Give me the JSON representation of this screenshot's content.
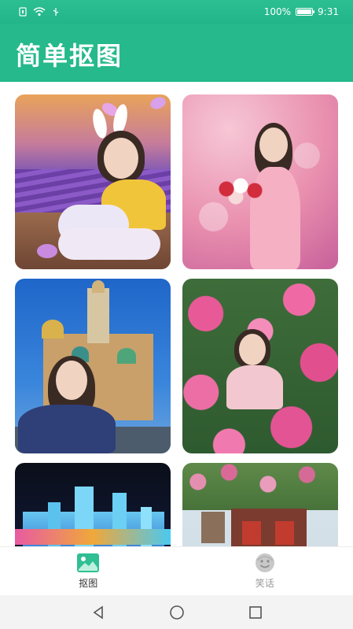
{
  "status": {
    "battery_text": "100%",
    "battery_level": 1.0,
    "time": "9:31"
  },
  "app": {
    "title": "简单抠图"
  },
  "gallery": {
    "items": [
      {
        "name": "lavender-girl"
      },
      {
        "name": "pink-flowers-girl"
      },
      {
        "name": "cathedral-woman"
      },
      {
        "name": "lily-girl"
      },
      {
        "name": "ice-castle"
      },
      {
        "name": "rose-gate"
      }
    ]
  },
  "bottom_nav": {
    "items": [
      {
        "label": "抠图",
        "icon": "image-icon",
        "active": true
      },
      {
        "label": "笑话",
        "icon": "face-icon",
        "active": false
      }
    ]
  },
  "colors": {
    "accent": "#25b98b",
    "nav_active": "#2fbf93"
  }
}
